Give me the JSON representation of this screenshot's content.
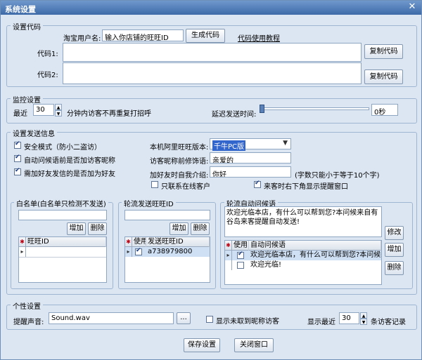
{
  "window": {
    "title": "系统设置"
  },
  "code_settings": {
    "group_label": "设置代码",
    "username_label": "淘宝用户名:",
    "username_value": "输入你店铺的旺旺ID",
    "generate_button": "生成代码",
    "help_link": "代码使用教程",
    "code1_label": "代码1:",
    "code2_label": "代码2:",
    "copy_button": "复制代码"
  },
  "monitor": {
    "group_label": "监控设置",
    "recent_label": "最近",
    "recent_value": "30",
    "no_repeat_label": "分钟内访客不再重复打招呼",
    "delay_label": "延迟发送时间:",
    "delay_value": "0秒",
    "delay_fraction": 0
  },
  "send_info": {
    "group_label": "设置发送信息",
    "safe_mode": {
      "label": "安全模式（防小二盗访）",
      "checked": true
    },
    "auto_greet": {
      "label": "自动问候语前是否加访客昵称",
      "checked": true
    },
    "add_friend": {
      "label": "需加好友发信的是否加为好友",
      "checked": true
    },
    "version_label": "本机阿里旺旺版本:",
    "version_value": "千牛PC版",
    "nickname_label": "访客昵称前修饰语:",
    "nickname_value": "亲爱的",
    "intro_label": "加好友时自我介绍:",
    "intro_value": "你好",
    "intro_hint": "(字数只能小于等于10个字)",
    "online_only": {
      "label": "只联系在线客户",
      "checked": false
    },
    "popup_notice": {
      "label": "来客时右下角显示提醒窗口",
      "checked": true
    }
  },
  "whitelist": {
    "group_label": "白名单(白名单只检测不发送)",
    "add_button": "增加",
    "delete_button": "删除",
    "col_id": "旺旺ID"
  },
  "rotation_ids": {
    "group_label": "轮流发送旺旺ID",
    "add_button": "增加",
    "delete_button": "删除",
    "col_use": "使用",
    "col_id": "发送旺旺ID",
    "rows": [
      {
        "use": true,
        "id": "a738979800"
      }
    ]
  },
  "greetings": {
    "group_label": "轮流自动问候语",
    "text": "欢迎光临本店，有什么可以帮到您?本问候来自有谷岛来客提醒自动发送!",
    "edit_button": "修改",
    "add_button": "增加",
    "delete_button": "删除",
    "col_use": "使用",
    "col_text": "自动问候语",
    "rows": [
      {
        "use": true,
        "text": "欢迎光临本店，有什么可以帮到您?本问候来"
      },
      {
        "use": false,
        "text": "欢迎光临!"
      }
    ]
  },
  "personal": {
    "group_label": "个性设置",
    "sound_label": "提醒声音:",
    "sound_value": "Sound.wav",
    "browse_button": "...",
    "show_unknown": {
      "label": "显示未取到昵称访客",
      "checked": false
    },
    "show_recent_label": "显示最近",
    "show_recent_value": "30",
    "records_label": "条访客记录"
  },
  "footer": {
    "save_button": "保存设置",
    "close_button": "关闭窗口"
  }
}
